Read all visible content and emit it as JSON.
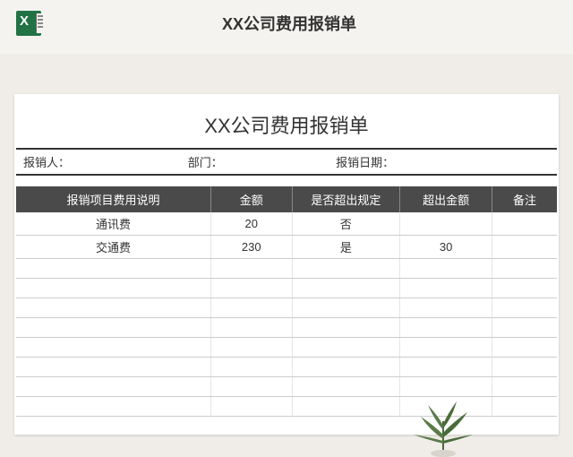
{
  "header": {
    "title": "XX公司费用报销单"
  },
  "sheet": {
    "title": "XX公司费用报销单",
    "meta": {
      "person_label": "报销人：",
      "dept_label": "部门：",
      "date_label": "报销日期："
    },
    "columns": {
      "desc": "报销项目费用说明",
      "amount": "金额",
      "over": "是否超出规定",
      "over_amount": "超出金额",
      "note": "备注"
    },
    "rows": [
      {
        "desc": "通讯费",
        "amount": "20",
        "over": "否",
        "over_amount": "",
        "note": ""
      },
      {
        "desc": "交通费",
        "amount": "230",
        "over": "是",
        "over_amount": "30",
        "note": ""
      },
      {
        "desc": "",
        "amount": "",
        "over": "",
        "over_amount": "",
        "note": ""
      },
      {
        "desc": "",
        "amount": "",
        "over": "",
        "over_amount": "",
        "note": ""
      },
      {
        "desc": "",
        "amount": "",
        "over": "",
        "over_amount": "",
        "note": ""
      },
      {
        "desc": "",
        "amount": "",
        "over": "",
        "over_amount": "",
        "note": ""
      },
      {
        "desc": "",
        "amount": "",
        "over": "",
        "over_amount": "",
        "note": ""
      },
      {
        "desc": "",
        "amount": "",
        "over": "",
        "over_amount": "",
        "note": ""
      },
      {
        "desc": "",
        "amount": "",
        "over": "",
        "over_amount": "",
        "note": ""
      },
      {
        "desc": "",
        "amount": "",
        "over": "",
        "over_amount": "",
        "note": ""
      }
    ]
  }
}
